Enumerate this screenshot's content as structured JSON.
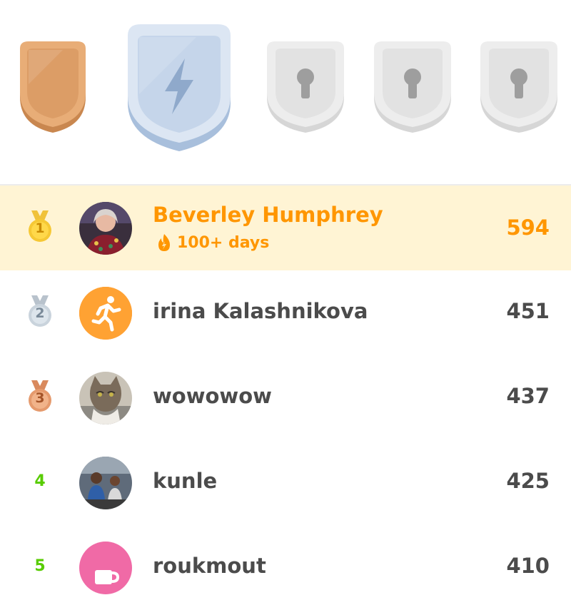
{
  "leagues": [
    {
      "name": "bronze-league",
      "icon": "shield-icon",
      "status": "completed",
      "color": "#e3a26e"
    },
    {
      "name": "silver-league",
      "icon": "lightning-bolt-icon",
      "status": "current",
      "color": "#c8d7ea"
    },
    {
      "name": "locked-league-3",
      "icon": "keyhole-lock-icon",
      "status": "locked",
      "color": "#e6e6e6"
    },
    {
      "name": "locked-league-4",
      "icon": "keyhole-lock-icon",
      "status": "locked",
      "color": "#e6e6e6"
    },
    {
      "name": "locked-league-5",
      "icon": "keyhole-lock-icon",
      "status": "locked",
      "color": "#e6e6e6"
    }
  ],
  "leaderboard": [
    {
      "rank": "1",
      "name": "Beverley Humphrey",
      "streak": "100+ days",
      "xp": "594",
      "highlight": true,
      "medal": "gold-medal-icon"
    },
    {
      "rank": "2",
      "name": "irina Kalashnikova",
      "xp": "451",
      "medal": "silver-medal-icon"
    },
    {
      "rank": "3",
      "name": "wowowow",
      "xp": "437",
      "medal": "bronze-medal-icon"
    },
    {
      "rank": "4",
      "name": "kunle",
      "xp": "425"
    },
    {
      "rank": "5",
      "name": "roukmout",
      "xp": "410"
    }
  ],
  "colors": {
    "accent": "#ff9600",
    "highlight_bg": "#fff4d4",
    "text": "#4b4b4b",
    "rank_green": "#58cc02"
  }
}
